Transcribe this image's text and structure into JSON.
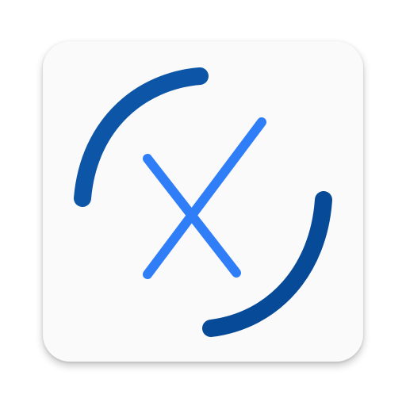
{
  "app_icon": {
    "icon_name": "x-in-broken-circle-icon",
    "colors": {
      "tile_background": "#fafafa",
      "arc_color_light": "#0d55a6",
      "arc_color_dark": "#064a98",
      "cross_color": "#2f7ef7"
    }
  }
}
